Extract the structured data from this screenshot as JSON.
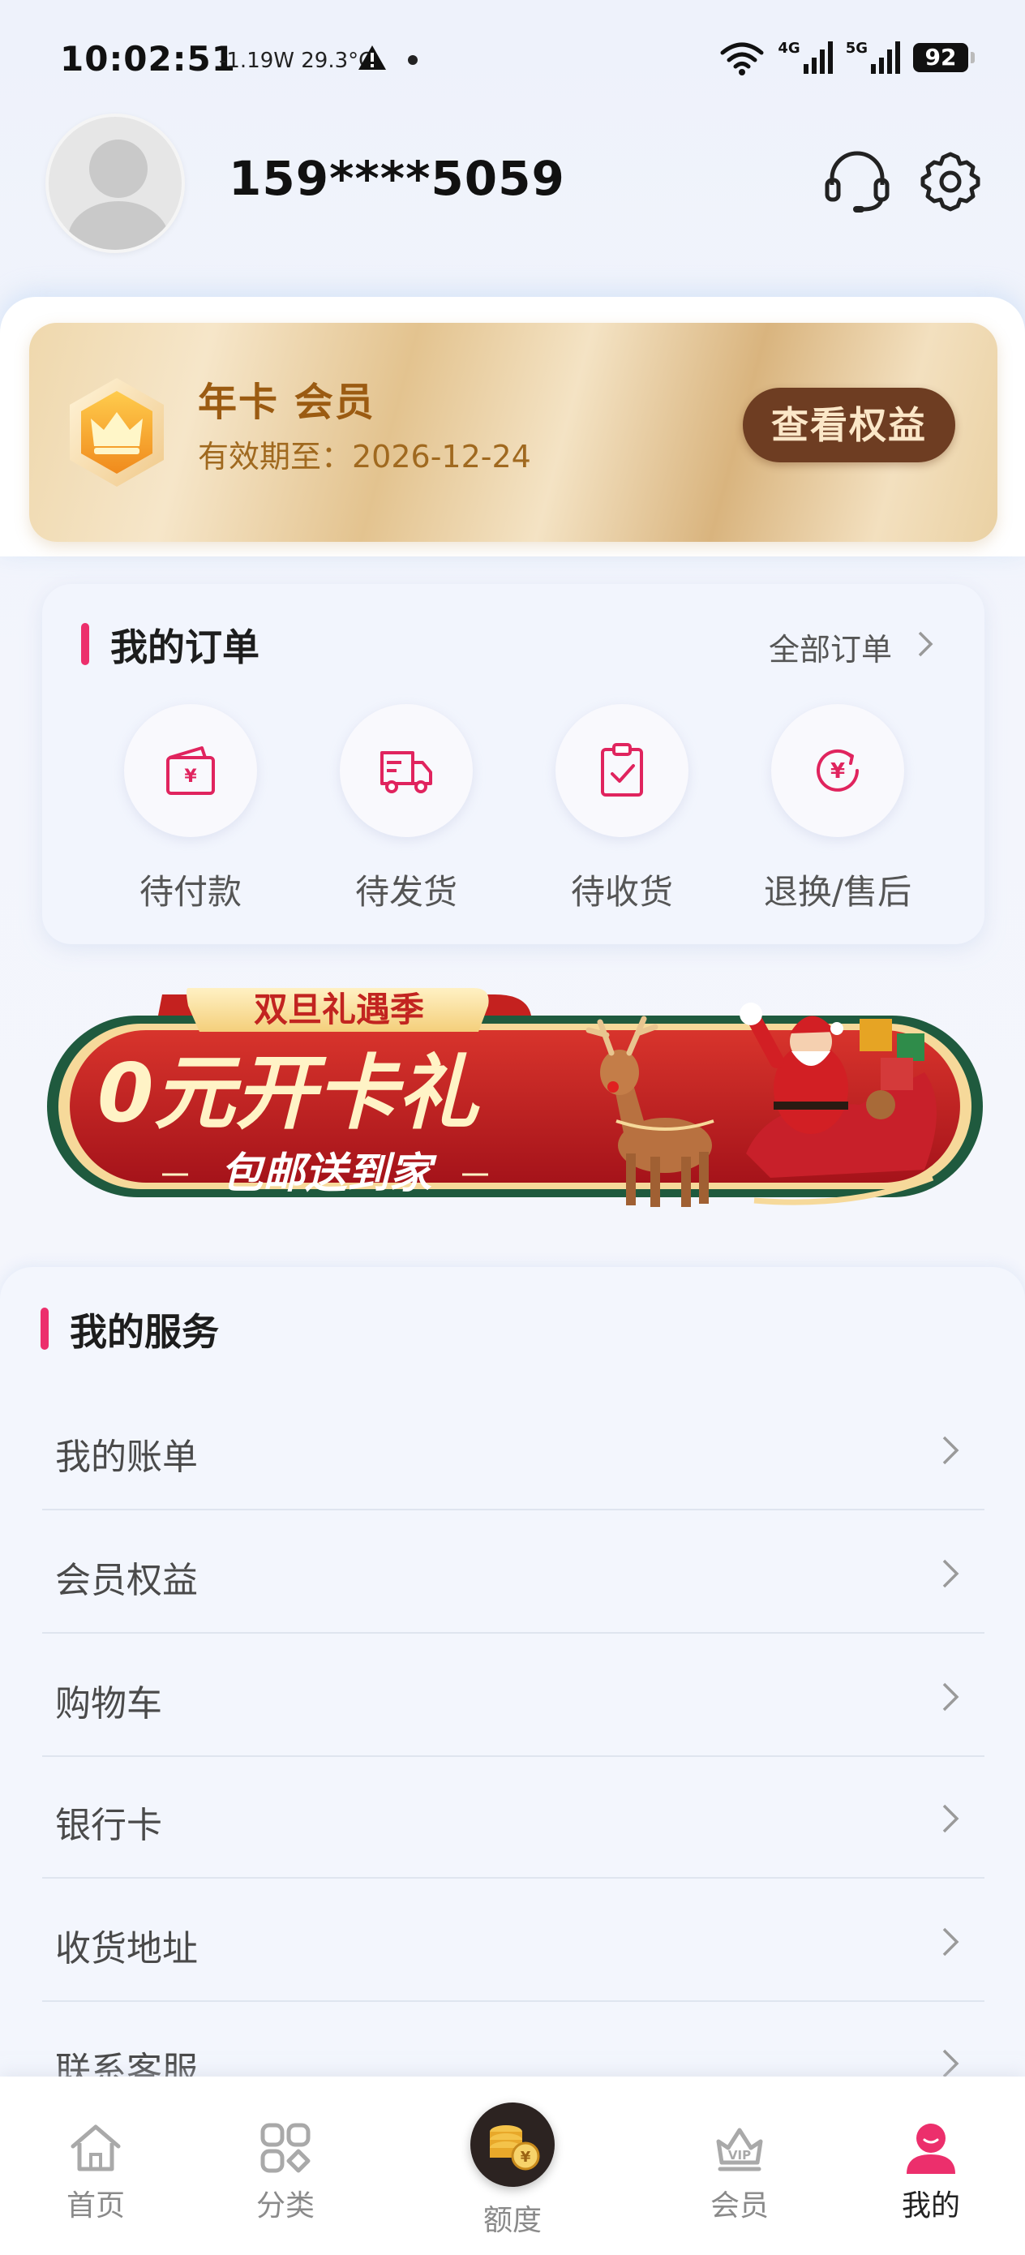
{
  "status_bar": {
    "time": "10:02:51",
    "power_temp": "-1.19W 29.3°C",
    "network_1": "4G",
    "network_2": "5G",
    "battery": "92"
  },
  "profile": {
    "phone": "159****5059",
    "icons": [
      "headset-icon",
      "gear-icon"
    ]
  },
  "membership": {
    "title": "年卡 会员",
    "expiry": "有效期至：2026-12-24",
    "button_label": "查看权益",
    "colors": {
      "title": "#9b5b12",
      "button_bg": "#6e3d22"
    }
  },
  "orders": {
    "title": "我的订单",
    "all_link": "全部订单",
    "items": [
      {
        "label": "待付款",
        "icon": "wallet-yuan-icon"
      },
      {
        "label": "待发货",
        "icon": "delivery-truck-icon"
      },
      {
        "label": "待收货",
        "icon": "clipboard-check-icon"
      },
      {
        "label": "退换/售后",
        "icon": "yuan-refund-icon"
      }
    ],
    "accent_color": "#ec2f6c"
  },
  "banner": {
    "tag": "双旦礼遇季",
    "headline": "0元开卡礼",
    "subline": "包邮送到家"
  },
  "services": {
    "title": "我的服务",
    "items": [
      {
        "label": "我的账单"
      },
      {
        "label": "会员权益"
      },
      {
        "label": "购物车"
      },
      {
        "label": "银行卡"
      },
      {
        "label": "收货地址"
      },
      {
        "label": "联系客服"
      }
    ]
  },
  "tab_bar": {
    "items": [
      {
        "label": "首页",
        "icon": "home-icon",
        "active": false
      },
      {
        "label": "分类",
        "icon": "category-grid-icon",
        "active": false
      },
      {
        "label": "额度",
        "icon": "coin-stack-icon",
        "active": false
      },
      {
        "label": "会员",
        "icon": "vip-crown-icon",
        "active": false
      },
      {
        "label": "我的",
        "icon": "person-icon",
        "active": true
      }
    ],
    "active_color": "#ec2f6c"
  }
}
